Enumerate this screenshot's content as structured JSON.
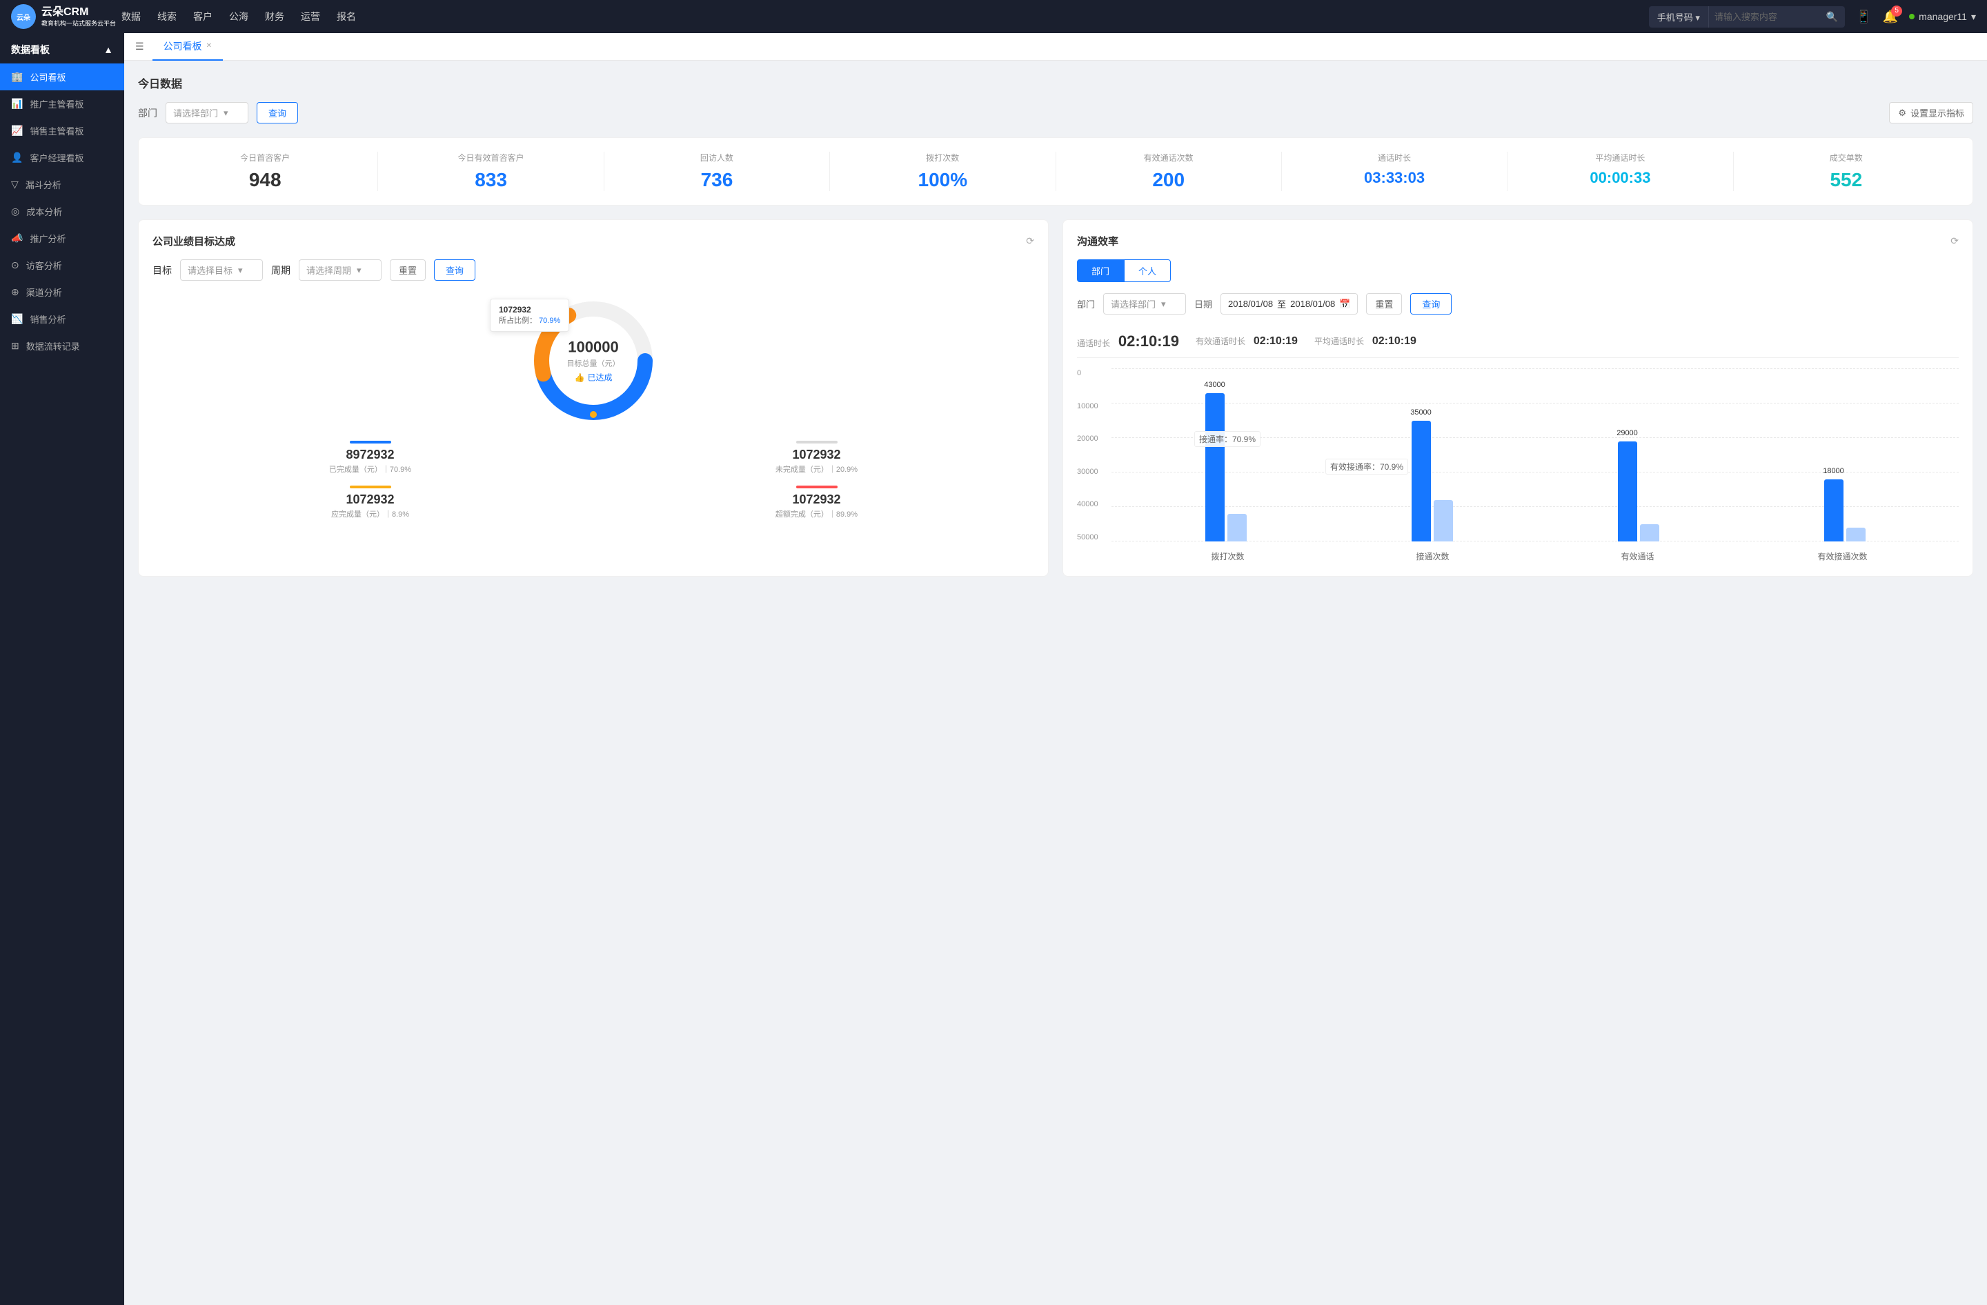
{
  "app": {
    "logo_brand": "云朵CRM",
    "logo_sub": "教育机构一站式服务云平台"
  },
  "nav": {
    "items": [
      "数据",
      "线索",
      "客户",
      "公海",
      "财务",
      "运营",
      "报名"
    ],
    "search_type": "手机号码",
    "search_placeholder": "请输入搜索内容",
    "user": "manager11"
  },
  "sidebar": {
    "section_title": "数据看板",
    "items": [
      {
        "label": "公司看板",
        "active": true,
        "icon": "🏢"
      },
      {
        "label": "推广主管看板",
        "active": false,
        "icon": "📊"
      },
      {
        "label": "销售主管看板",
        "active": false,
        "icon": "📈"
      },
      {
        "label": "客户经理看板",
        "active": false,
        "icon": "👤"
      },
      {
        "label": "漏斗分析",
        "active": false,
        "icon": "⬇"
      },
      {
        "label": "成本分析",
        "active": false,
        "icon": "💰"
      },
      {
        "label": "推广分析",
        "active": false,
        "icon": "📣"
      },
      {
        "label": "访客分析",
        "active": false,
        "icon": "👁"
      },
      {
        "label": "渠道分析",
        "active": false,
        "icon": "🔗"
      },
      {
        "label": "销售分析",
        "active": false,
        "icon": "📉"
      },
      {
        "label": "数据流转记录",
        "active": false,
        "icon": "🔄"
      }
    ]
  },
  "tab_bar": {
    "active_tab": "公司看板"
  },
  "today_data": {
    "section_title": "今日数据",
    "filter_label": "部门",
    "filter_placeholder": "请选择部门",
    "query_btn": "查询",
    "settings_btn": "设置显示指标",
    "stats": [
      {
        "label": "今日首咨客户",
        "value": "948",
        "color": "dark"
      },
      {
        "label": "今日有效首咨客户",
        "value": "833",
        "color": "blue"
      },
      {
        "label": "回访人数",
        "value": "736",
        "color": "blue"
      },
      {
        "label": "拨打次数",
        "value": "100%",
        "color": "blue"
      },
      {
        "label": "有效通话次数",
        "value": "200",
        "color": "blue"
      },
      {
        "label": "通话时长",
        "value": "03:33:03",
        "color": "blue"
      },
      {
        "label": "平均通话时长",
        "value": "00:00:33",
        "color": "cyan"
      },
      {
        "label": "成交单数",
        "value": "552",
        "color": "teal"
      }
    ]
  },
  "target_panel": {
    "title": "公司业绩目标达成",
    "target_label": "目标",
    "target_placeholder": "请选择目标",
    "period_label": "周期",
    "period_placeholder": "请选择周期",
    "reset_btn": "重置",
    "query_btn": "查询",
    "donut": {
      "center_value": "100000",
      "center_label": "目标总量（元）",
      "achieved_label": "已达成",
      "tooltip_value": "1072932",
      "tooltip_pct": "70.9%",
      "tooltip_pct_label": "所占比例："
    },
    "stats": [
      {
        "label": "已完成量（元）｜70.9%",
        "value": "8972932",
        "bar_color": "#1677ff"
      },
      {
        "label": "未完成量（元）｜20.9%",
        "value": "1072932",
        "bar_color": "#d9d9d9"
      },
      {
        "label": "应完成量（元）｜8.9%",
        "value": "1072932",
        "bar_color": "#faad14"
      },
      {
        "label": "超额完成（元）｜89.9%",
        "value": "1072932",
        "bar_color": "#ff4d4f"
      }
    ]
  },
  "efficiency_panel": {
    "title": "沟通效率",
    "tabs": [
      "部门",
      "个人"
    ],
    "active_tab": "部门",
    "dept_label": "部门",
    "dept_placeholder": "请选择部门",
    "date_label": "日期",
    "date_start": "2018/01/08",
    "date_end": "2018/01/08",
    "reset_btn": "重置",
    "query_btn": "查询",
    "call_duration": "02:10:19",
    "effective_call_label": "有效通话时长",
    "effective_call_value": "02:10:19",
    "avg_call_label": "平均通话时长",
    "avg_call_value": "02:10:19",
    "call_duration_label": "通话时长",
    "chart": {
      "y_labels": [
        "0",
        "10000",
        "20000",
        "30000",
        "40000",
        "50000"
      ],
      "categories": [
        {
          "name": "拨打次数",
          "bars": [
            {
              "value": 43000,
              "color": "#1677ff",
              "label": "43000"
            },
            {
              "value": 8000,
              "color": "#b0d0ff",
              "label": ""
            }
          ]
        },
        {
          "name": "接通次数",
          "bars": [
            {
              "value": 35000,
              "color": "#1677ff",
              "label": "35000"
            },
            {
              "value": 12000,
              "color": "#b0d0ff",
              "label": ""
            }
          ]
        },
        {
          "name": "有效通话",
          "bars": [
            {
              "value": 29000,
              "color": "#1677ff",
              "label": "29000"
            },
            {
              "value": 5000,
              "color": "#b0d0ff",
              "label": ""
            }
          ]
        },
        {
          "name": "有效接通次数",
          "bars": [
            {
              "value": 18000,
              "color": "#1677ff",
              "label": "18000"
            },
            {
              "value": 4000,
              "color": "#b0d0ff",
              "label": ""
            }
          ]
        }
      ],
      "annotation1": "接通率：70.9%",
      "annotation2": "有效接通率：70.9%"
    }
  }
}
